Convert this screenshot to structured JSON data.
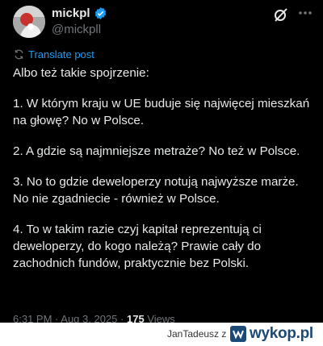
{
  "post": {
    "display_name": "mickpl",
    "handle": "@mickpll",
    "translate_label": "Translate post",
    "paragraphs": [
      "Albo też takie spojrzenie:",
      "1. W którym kraju w UE buduje się najwięcej mieszkań na głowę? No w Polsce.",
      "2. A gdzie są najmniejsze metraże? No też w Polsce.",
      "3. No to gdzie deweloperzy notują najwyższe marże. No nie zgadniecie - również w Polsce.",
      "4. To w takim razie czyj kapitał reprezentują ci deweloperzy, do kogo należą? Prawie cały do zachodnich fundów, praktycznie bez Polski."
    ],
    "time": "6:31 PM",
    "date": "Aug 3, 2025",
    "views_count": "175",
    "views_label": "Views"
  },
  "footer": {
    "user": "JanTadeusz",
    "prefix": "z",
    "logo": "wykop.pl"
  },
  "colors": {
    "accent": "#1d9bf0",
    "background": "#000000",
    "text": "#e7e9ea",
    "muted": "#71767b"
  },
  "icons": [
    "verified-badge-icon",
    "grok-icon",
    "more-icon",
    "translate-icon",
    "wykop-logo-icon"
  ]
}
